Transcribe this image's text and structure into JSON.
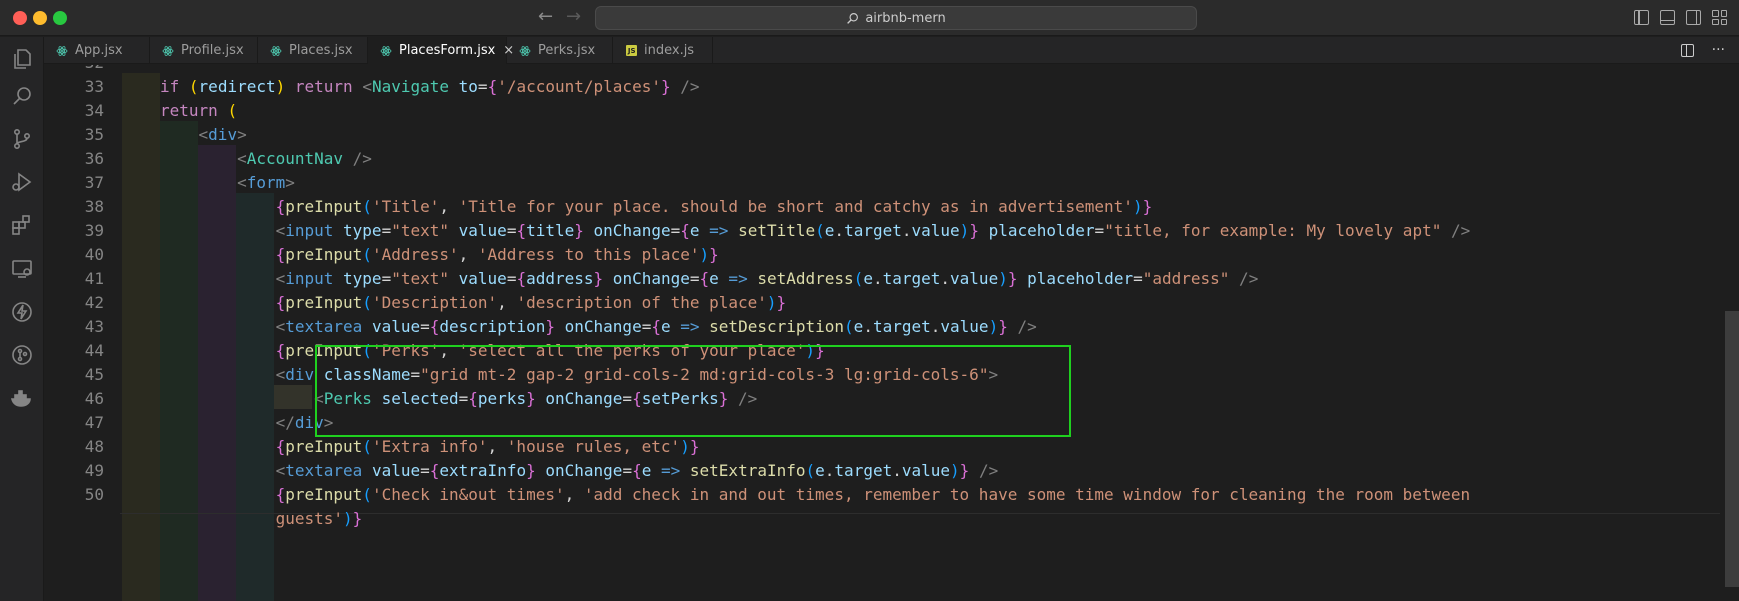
{
  "window": {
    "title": "airbnb-mern"
  },
  "tabs": [
    {
      "label": "App.jsx",
      "icon": "react-icon",
      "active": false
    },
    {
      "label": "Profile.jsx",
      "icon": "react-icon",
      "active": false
    },
    {
      "label": "Places.jsx",
      "icon": "react-icon",
      "active": false
    },
    {
      "label": "PlacesForm.jsx",
      "icon": "react-icon",
      "active": true
    },
    {
      "label": "Perks.jsx",
      "icon": "react-icon",
      "active": false
    },
    {
      "label": "index.js",
      "icon": "javascript-icon",
      "active": false
    }
  ],
  "tab_close_glyph": "×",
  "tab_more_glyph": "···",
  "js_badge": "JS",
  "activity_icons": [
    "explorer-icon",
    "search-icon",
    "source-control-icon",
    "run-debug-icon",
    "extensions-icon",
    "remote-explorer-icon",
    "thunder-client-icon",
    "git-graph-icon",
    "docker-icon"
  ],
  "editor": {
    "line_numbers": [
      "32",
      "33",
      "34",
      "35",
      "36",
      "37",
      "38",
      "39",
      "40",
      "41",
      "42",
      "43",
      "44",
      "45",
      "46",
      "47",
      "48",
      "49",
      "50",
      ""
    ],
    "highlight_lines": [
      "44",
      "47"
    ],
    "lines": [
      [],
      [
        [
          "ctrl",
          "if "
        ],
        [
          "br1",
          "("
        ],
        [
          "var",
          "redirect"
        ],
        [
          "br1",
          ")"
        ],
        [
          "ctrl",
          " return "
        ],
        [
          "punc",
          "<"
        ],
        [
          "tag",
          "Navigate "
        ],
        [
          "attr",
          "to"
        ],
        [
          "txt",
          "="
        ],
        [
          "br2",
          "{"
        ],
        [
          "str",
          "'/account/places'"
        ],
        [
          "br2",
          "}"
        ],
        [
          "punc",
          " />"
        ]
      ],
      [
        [
          "ctrl",
          "return "
        ],
        [
          "br1",
          "("
        ]
      ],
      [
        [
          "punc",
          "    <"
        ],
        [
          "tagp",
          "div"
        ],
        [
          "punc",
          ">"
        ]
      ],
      [
        [
          "punc",
          "        <"
        ],
        [
          "tag",
          "AccountNav"
        ],
        [
          "punc",
          " />"
        ]
      ],
      [
        [
          "punc",
          "        <"
        ],
        [
          "tagp",
          "form"
        ],
        [
          "punc",
          ">"
        ]
      ],
      [
        [
          "br2",
          "            {"
        ],
        [
          "fn",
          "preInput"
        ],
        [
          "br3",
          "("
        ],
        [
          "str",
          "'Title'"
        ],
        [
          "txt",
          ", "
        ],
        [
          "str",
          "'Title for your place. should be short and catchy as in advertisement'"
        ],
        [
          "br3",
          ")"
        ],
        [
          "br2",
          "}"
        ]
      ],
      [
        [
          "punc",
          "            <"
        ],
        [
          "tagp",
          "input "
        ],
        [
          "attr",
          "type"
        ],
        [
          "txt",
          "="
        ],
        [
          "str",
          "\"text\" "
        ],
        [
          "attr",
          "value"
        ],
        [
          "txt",
          "="
        ],
        [
          "br2",
          "{"
        ],
        [
          "var",
          "title"
        ],
        [
          "br2",
          "}"
        ],
        [
          "attr",
          " onChange"
        ],
        [
          "txt",
          "="
        ],
        [
          "br2",
          "{"
        ],
        [
          "var",
          "e"
        ],
        [
          "kw",
          " =>"
        ],
        [
          "fn",
          " setTitle"
        ],
        [
          "br3",
          "("
        ],
        [
          "var",
          "e"
        ],
        [
          "txt",
          "."
        ],
        [
          "var",
          "target"
        ],
        [
          "txt",
          "."
        ],
        [
          "var",
          "value"
        ],
        [
          "br3",
          ")"
        ],
        [
          "br2",
          "}"
        ],
        [
          "attr",
          " placeholder"
        ],
        [
          "txt",
          "="
        ],
        [
          "str",
          "\"title, for example: My lovely apt\""
        ],
        [
          "punc",
          " />"
        ]
      ],
      [
        [
          "br2",
          "            {"
        ],
        [
          "fn",
          "preInput"
        ],
        [
          "br3",
          "("
        ],
        [
          "str",
          "'Address'"
        ],
        [
          "txt",
          ", "
        ],
        [
          "str",
          "'Address to this place'"
        ],
        [
          "br3",
          ")"
        ],
        [
          "br2",
          "}"
        ]
      ],
      [
        [
          "punc",
          "            <"
        ],
        [
          "tagp",
          "input "
        ],
        [
          "attr",
          "type"
        ],
        [
          "txt",
          "="
        ],
        [
          "str",
          "\"text\" "
        ],
        [
          "attr",
          "value"
        ],
        [
          "txt",
          "="
        ],
        [
          "br2",
          "{"
        ],
        [
          "var",
          "address"
        ],
        [
          "br2",
          "}"
        ],
        [
          "attr",
          " onChange"
        ],
        [
          "txt",
          "="
        ],
        [
          "br2",
          "{"
        ],
        [
          "var",
          "e"
        ],
        [
          "kw",
          " =>"
        ],
        [
          "fn",
          " setAddress"
        ],
        [
          "br3",
          "("
        ],
        [
          "var",
          "e"
        ],
        [
          "txt",
          "."
        ],
        [
          "var",
          "target"
        ],
        [
          "txt",
          "."
        ],
        [
          "var",
          "value"
        ],
        [
          "br3",
          ")"
        ],
        [
          "br2",
          "}"
        ],
        [
          "attr",
          " placeholder"
        ],
        [
          "txt",
          "="
        ],
        [
          "str",
          "\"address\""
        ],
        [
          "punc",
          " />"
        ]
      ],
      [
        [
          "br2",
          "            {"
        ],
        [
          "fn",
          "preInput"
        ],
        [
          "br3",
          "("
        ],
        [
          "str",
          "'Description'"
        ],
        [
          "txt",
          ", "
        ],
        [
          "str",
          "'description of the place'"
        ],
        [
          "br3",
          ")"
        ],
        [
          "br2",
          "}"
        ]
      ],
      [
        [
          "punc",
          "            <"
        ],
        [
          "tagp",
          "textarea "
        ],
        [
          "attr",
          "value"
        ],
        [
          "txt",
          "="
        ],
        [
          "br2",
          "{"
        ],
        [
          "var",
          "description"
        ],
        [
          "br2",
          "}"
        ],
        [
          "attr",
          " onChange"
        ],
        [
          "txt",
          "="
        ],
        [
          "br2",
          "{"
        ],
        [
          "var",
          "e"
        ],
        [
          "kw",
          " =>"
        ],
        [
          "fn",
          " setDescription"
        ],
        [
          "br3",
          "("
        ],
        [
          "var",
          "e"
        ],
        [
          "txt",
          "."
        ],
        [
          "var",
          "target"
        ],
        [
          "txt",
          "."
        ],
        [
          "var",
          "value"
        ],
        [
          "br3",
          ")"
        ],
        [
          "br2",
          "}"
        ],
        [
          "punc",
          " />"
        ]
      ],
      [
        [
          "br2",
          "            {"
        ],
        [
          "fn",
          "preInput"
        ],
        [
          "br3",
          "("
        ],
        [
          "str",
          "'Perks'"
        ],
        [
          "txt",
          ", "
        ],
        [
          "str",
          "'select all the perks of your place'"
        ],
        [
          "br3",
          ")"
        ],
        [
          "br2",
          "}"
        ]
      ],
      [
        [
          "punc",
          "            <"
        ],
        [
          "tagp",
          "div "
        ],
        [
          "attr",
          "className"
        ],
        [
          "txt",
          "="
        ],
        [
          "str",
          "\"grid mt-2 gap-2 grid-cols-2 md:grid-cols-3 lg:grid-cols-6\""
        ],
        [
          "punc",
          ">"
        ]
      ],
      [
        [
          "punc",
          "                <"
        ],
        [
          "tag",
          "Perks "
        ],
        [
          "attr",
          "selected"
        ],
        [
          "txt",
          "="
        ],
        [
          "br2",
          "{"
        ],
        [
          "var",
          "perks"
        ],
        [
          "br2",
          "}"
        ],
        [
          "attr",
          " onChange"
        ],
        [
          "txt",
          "="
        ],
        [
          "br2",
          "{"
        ],
        [
          "var",
          "setPerks"
        ],
        [
          "br2",
          "}"
        ],
        [
          "punc",
          " />"
        ]
      ],
      [
        [
          "punc",
          "            </"
        ],
        [
          "tagp",
          "div"
        ],
        [
          "punc",
          ">"
        ]
      ],
      [
        [
          "br2",
          "            {"
        ],
        [
          "fn",
          "preInput"
        ],
        [
          "br3",
          "("
        ],
        [
          "str",
          "'Extra info'"
        ],
        [
          "txt",
          ", "
        ],
        [
          "str",
          "'house rules, etc'"
        ],
        [
          "br3",
          ")"
        ],
        [
          "br2",
          "}"
        ]
      ],
      [
        [
          "punc",
          "            <"
        ],
        [
          "tagp",
          "textarea "
        ],
        [
          "attr",
          "value"
        ],
        [
          "txt",
          "="
        ],
        [
          "br2",
          "{"
        ],
        [
          "var",
          "extraInfo"
        ],
        [
          "br2",
          "}"
        ],
        [
          "attr",
          " onChange"
        ],
        [
          "txt",
          "="
        ],
        [
          "br2",
          "{"
        ],
        [
          "var",
          "e"
        ],
        [
          "kw",
          " =>"
        ],
        [
          "fn",
          " setExtraInfo"
        ],
        [
          "br3",
          "("
        ],
        [
          "var",
          "e"
        ],
        [
          "txt",
          "."
        ],
        [
          "var",
          "target"
        ],
        [
          "txt",
          "."
        ],
        [
          "var",
          "value"
        ],
        [
          "br3",
          ")"
        ],
        [
          "br2",
          "}"
        ],
        [
          "punc",
          " />"
        ]
      ],
      [
        [
          "br2",
          "            {"
        ],
        [
          "fn",
          "preInput"
        ],
        [
          "br3",
          "("
        ],
        [
          "str",
          "'Check in&out times'"
        ],
        [
          "txt",
          ", "
        ],
        [
          "str",
          "'add check in and out times, remember to have some time window for cleaning the room between"
        ]
      ],
      [
        [
          "str",
          "            guests'"
        ],
        [
          "br3",
          ")"
        ],
        [
          "br2",
          "}"
        ]
      ]
    ]
  }
}
